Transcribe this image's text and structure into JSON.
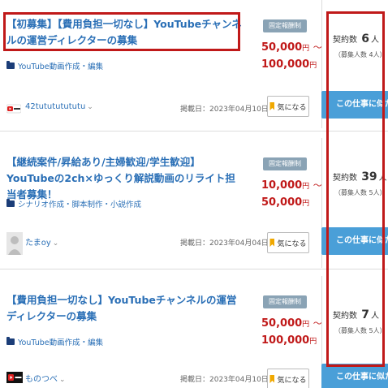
{
  "badge_label": "固定報酬制",
  "favorite_label": "気になる",
  "cta_label": "この仕事に似た仕",
  "jobs": [
    {
      "title": "【初募集】【費用負担一切なし】YouTubeチャンネルの運営ディレクターの募集",
      "category": "YouTube動画作成・編集",
      "price_from": "50,000",
      "price_to": "100,000",
      "yen": "円",
      "tilde": "〜",
      "contract_label": "契約数",
      "contract_count": "6",
      "contract_unit": "人",
      "recruit": "（募集人数 4人）",
      "user": "42tutututututu",
      "date": "掲載日：2023年04月10日",
      "avatar_icon": "youtube-logo-icon"
    },
    {
      "title": "【継続案件/昇給あり/主婦歓迎/学生歓迎】YouTubeの2ch×ゆっくり解説動画のリライト担当者募集！",
      "category": "シナリオ作成・脚本制作・小説作成",
      "price_from": "10,000",
      "price_to": "50,000",
      "yen": "円",
      "tilde": "〜",
      "contract_label": "契約数",
      "contract_count": "39",
      "contract_unit": "人",
      "recruit": "（募集人数 5人）",
      "user": "たまoy",
      "date": "掲載日：2023年04月04日",
      "avatar_icon": "default-user-icon"
    },
    {
      "title": "【費用負担一切なし】YouTubeチャンネルの運営ディレクターの募集",
      "category": "YouTube動画作成・編集",
      "price_from": "50,000",
      "price_to": "100,000",
      "yen": "円",
      "tilde": "〜",
      "contract_label": "契約数",
      "contract_count": "7",
      "contract_unit": "人",
      "recruit": "（募集人数 5人）",
      "user": "ものつべ",
      "date": "掲載日：2023年04月10日",
      "avatar_icon": "youtube-logo-icon"
    }
  ],
  "colors": {
    "title": "#2a6fb6",
    "price": "#c01919",
    "badge": "#8aa3b5",
    "cta": "#4a9fd8",
    "highlight": "#c01919",
    "bookmark": "#f0a800"
  }
}
